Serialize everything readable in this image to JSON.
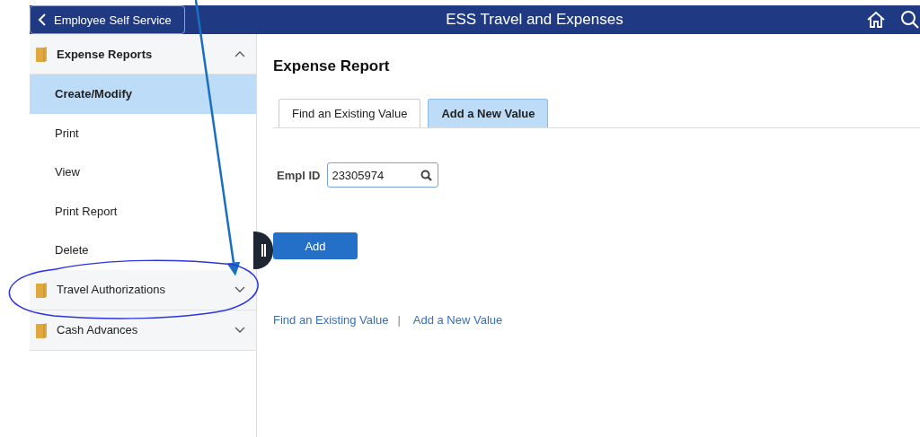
{
  "header": {
    "back_button": "Employee Self Service",
    "title": "ESS Travel and Expenses"
  },
  "sidebar": {
    "groups": [
      {
        "label": "Expense Reports",
        "expanded": true,
        "items": [
          {
            "label": "Create/Modify",
            "selected": true
          },
          {
            "label": "Print",
            "selected": false
          },
          {
            "label": "View",
            "selected": false
          },
          {
            "label": "Print Report",
            "selected": false
          },
          {
            "label": "Delete",
            "selected": false
          }
        ]
      },
      {
        "label": "Travel Authorizations",
        "expanded": false
      },
      {
        "label": "Cash Advances",
        "expanded": false
      }
    ]
  },
  "main": {
    "heading": "Expense Report",
    "tabs": [
      {
        "label": "Find an Existing Value",
        "selected": false
      },
      {
        "label": "Add a New Value",
        "selected": true
      }
    ],
    "field": {
      "label": "Empl ID",
      "value": "23305974"
    },
    "add_button": "Add",
    "links": [
      "Find an Existing Value",
      "Add a New Value"
    ],
    "link_separator": "|"
  }
}
